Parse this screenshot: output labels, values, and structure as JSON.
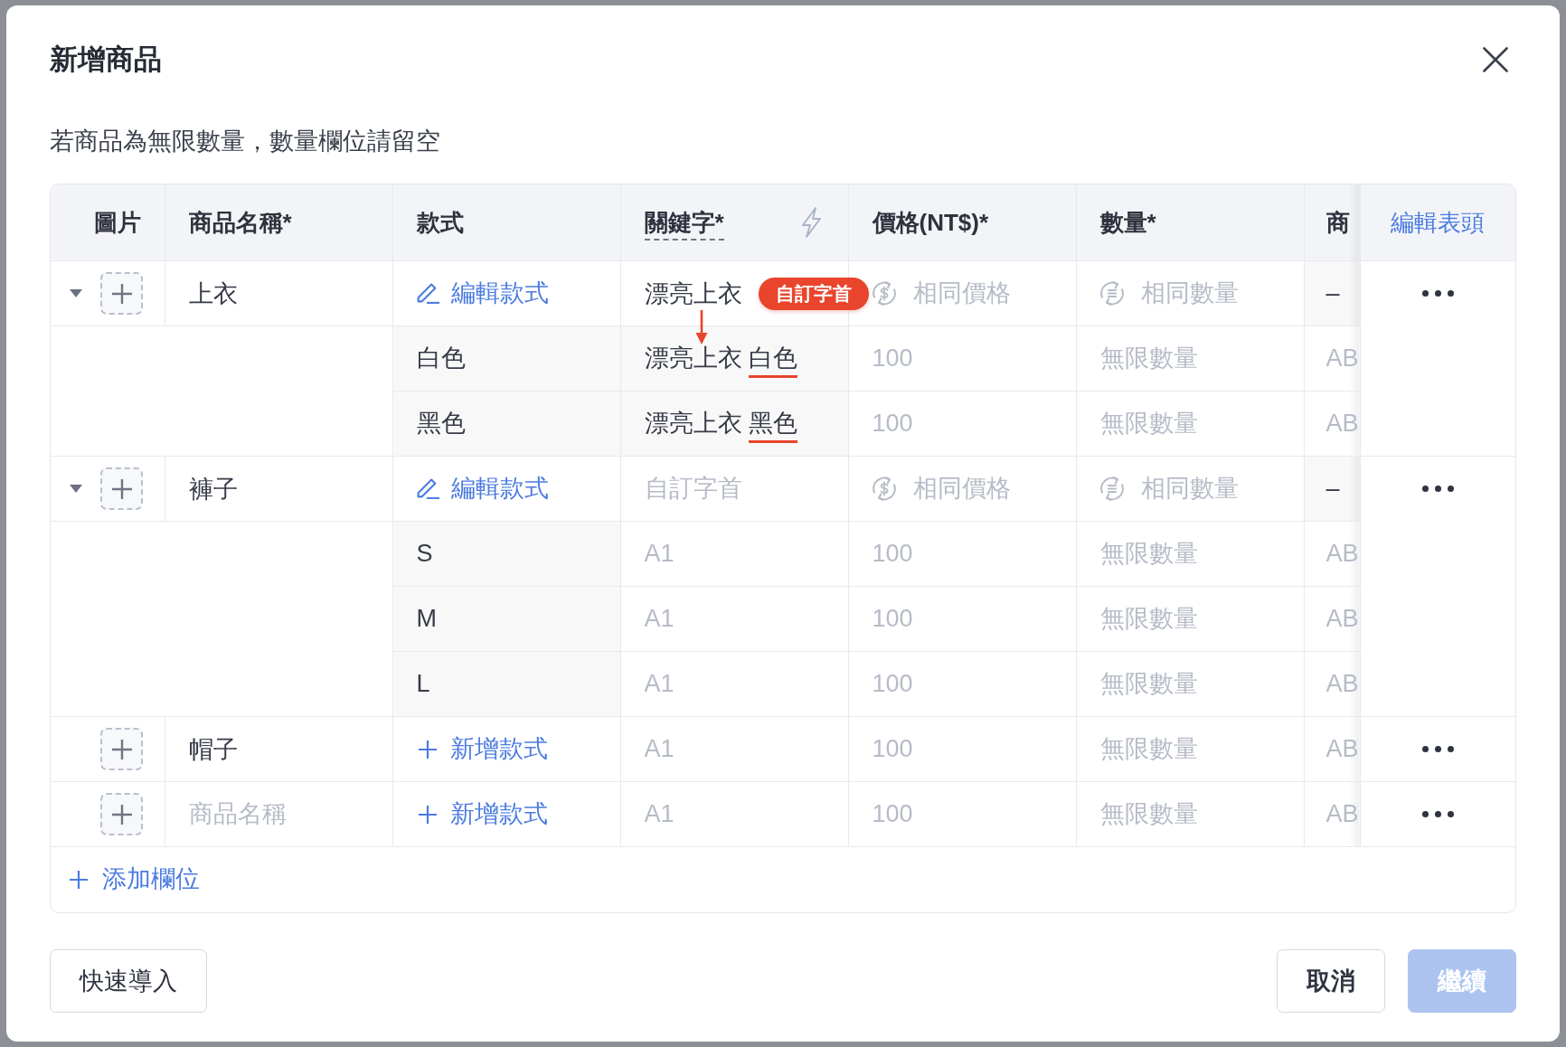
{
  "dialog": {
    "title": "新增商品",
    "hint": "若商品為無限數量，數量欄位請留空"
  },
  "table": {
    "columns": [
      {
        "label": "圖片",
        "kind": "plain"
      },
      {
        "label": "商品名稱*",
        "kind": "plain"
      },
      {
        "label": "款式",
        "kind": "plain"
      },
      {
        "label": "關鍵字*",
        "kind": "tooltip"
      },
      {
        "label": "價格(NT$)*",
        "kind": "plain"
      },
      {
        "label": "數量*",
        "kind": "plain"
      },
      {
        "label": "商",
        "kind": "plain"
      },
      {
        "label": "編輯表頭",
        "kind": "link"
      }
    ],
    "products": [
      {
        "expanded": true,
        "name": {
          "kind": "field",
          "value": "上衣"
        },
        "style": {
          "kind": "edit",
          "label": "編輯款式"
        },
        "keyword": {
          "kind": "field",
          "value": "漂亮上衣",
          "badge": "自訂字首",
          "arrow": true
        },
        "price": {
          "kind": "same",
          "label": "相同價格"
        },
        "quantity": {
          "kind": "same",
          "label": "相同數量"
        },
        "column_7": {
          "kind": "text",
          "text": "–"
        },
        "variants": [
          {
            "style": {
              "kind": "text",
              "text": "白色"
            },
            "keyword": {
              "kind": "derived",
              "prefix": "漂亮上衣",
              "suffix": "白色"
            },
            "price": {
              "kind": "field",
              "placeholder": "100"
            },
            "quantity": {
              "kind": "field",
              "placeholder": "無限數量"
            },
            "column_7": {
              "kind": "field",
              "placeholder": "AB"
            }
          },
          {
            "style": {
              "kind": "text",
              "text": "黑色"
            },
            "keyword": {
              "kind": "derived",
              "prefix": "漂亮上衣",
              "suffix": "黑色"
            },
            "price": {
              "kind": "field",
              "placeholder": "100"
            },
            "quantity": {
              "kind": "field",
              "placeholder": "無限數量"
            },
            "column_7": {
              "kind": "field",
              "placeholder": "AB"
            }
          }
        ]
      },
      {
        "expanded": true,
        "name": {
          "kind": "field",
          "value": "褲子"
        },
        "style": {
          "kind": "edit",
          "label": "編輯款式"
        },
        "keyword": {
          "kind": "field",
          "placeholder": "自訂字首"
        },
        "price": {
          "kind": "same",
          "label": "相同價格"
        },
        "quantity": {
          "kind": "same",
          "label": "相同數量"
        },
        "column_7": {
          "kind": "text",
          "text": "–"
        },
        "variants": [
          {
            "style": {
              "kind": "text",
              "text": "S"
            },
            "keyword": {
              "kind": "field",
              "placeholder": "A1"
            },
            "price": {
              "kind": "field",
              "placeholder": "100"
            },
            "quantity": {
              "kind": "field",
              "placeholder": "無限數量"
            },
            "column_7": {
              "kind": "field",
              "placeholder": "AB"
            }
          },
          {
            "style": {
              "kind": "text",
              "text": "M"
            },
            "keyword": {
              "kind": "field",
              "placeholder": "A1"
            },
            "price": {
              "kind": "field",
              "placeholder": "100"
            },
            "quantity": {
              "kind": "field",
              "placeholder": "無限數量"
            },
            "column_7": {
              "kind": "field",
              "placeholder": "AB"
            }
          },
          {
            "style": {
              "kind": "text",
              "text": "L"
            },
            "keyword": {
              "kind": "field",
              "placeholder": "A1"
            },
            "price": {
              "kind": "field",
              "placeholder": "100"
            },
            "quantity": {
              "kind": "field",
              "placeholder": "無限數量"
            },
            "column_7": {
              "kind": "field",
              "placeholder": "AB"
            }
          }
        ]
      },
      {
        "name": {
          "kind": "field",
          "value": "帽子"
        },
        "style": {
          "kind": "add",
          "label": "新增款式"
        },
        "keyword": {
          "kind": "field",
          "placeholder": "A1"
        },
        "price": {
          "kind": "field",
          "placeholder": "100"
        },
        "quantity": {
          "kind": "field",
          "placeholder": "無限數量"
        },
        "column_7": {
          "kind": "field",
          "placeholder": "AB"
        }
      },
      {
        "name": {
          "kind": "field",
          "placeholder": "商品名稱"
        },
        "style": {
          "kind": "add",
          "label": "新增款式"
        },
        "keyword": {
          "kind": "field",
          "placeholder": "A1"
        },
        "price": {
          "kind": "field",
          "placeholder": "100"
        },
        "quantity": {
          "kind": "field",
          "placeholder": "無限數量"
        },
        "column_7": {
          "kind": "field",
          "placeholder": "AB"
        }
      }
    ],
    "add_column": {
      "label": "添加欄位"
    }
  },
  "footer": {
    "left": [
      {
        "label": "快速導入",
        "kind": "secondary",
        "disabled": false
      }
    ],
    "right": [
      {
        "label": "取消",
        "kind": "secondary",
        "disabled": false
      },
      {
        "label": "繼續",
        "kind": "primary",
        "disabled": true
      }
    ]
  }
}
